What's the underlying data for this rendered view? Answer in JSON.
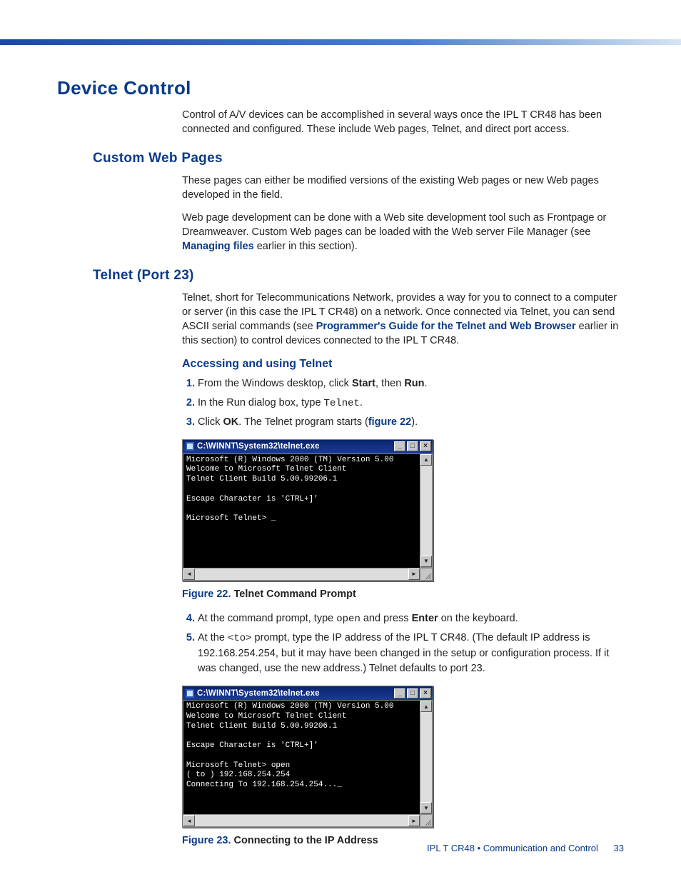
{
  "h1": "Device Control",
  "intro": "Control of A/V devices can be accomplished in several ways once the IPL T CR48 has been connected and configured. These include Web pages, Telnet, and direct port access.",
  "sections": {
    "cwp": {
      "title": "Custom Web Pages",
      "p1": "These pages can either be modified versions of the existing Web pages or new Web pages developed in the field.",
      "p2a": "Web page development can be done with a Web site development tool such as Frontpage or Dreamweaver. Custom Web pages can be loaded with the Web server File Manager (see ",
      "p2_link": "Managing files",
      "p2b": " earlier in this section)."
    },
    "telnet": {
      "title": "Telnet (Port 23)",
      "p1a": "Telnet, short for Telecommunications Network, provides a way for you to connect to a computer or server (in this case the IPL T CR48) on a network. Once connected via Telnet, you can send ASCII serial commands (see ",
      "p1_link": "Programmer's Guide for the Telnet and Web Browser",
      "p1b": " earlier in this section) to control devices connected to the IPL T CR48.",
      "h3": "Accessing and using Telnet",
      "steps": {
        "s1a": "From the Windows desktop, click ",
        "s1_start": "Start",
        "s1b": ", then ",
        "s1_run": "Run",
        "s1c": ".",
        "s2a": "In the Run dialog box, type ",
        "s2_code": "Telnet",
        "s2b": ".",
        "s3a": "Click ",
        "s3_ok": "OK",
        "s3b": ". The Telnet program starts (",
        "s3_fig": "figure 22",
        "s3c": ").",
        "s4a": "At the command prompt, type ",
        "s4_code": "open",
        "s4b": " and press ",
        "s4_enter": "Enter",
        "s4c": " on the keyboard.",
        "s5a": "At the ",
        "s5_code": "<to>",
        "s5b": " prompt, type the IP address of the IPL T CR48. (The default IP address is 192.168.254.254, but it may have been changed in the setup or configuration process. If it was changed, use the new address.) Telnet defaults to port 23."
      }
    }
  },
  "figures": {
    "f22": {
      "label": "Figure 22.",
      "title": "Telnet Command Prompt"
    },
    "f23": {
      "label": "Figure 23.",
      "title": "Connecting to the IP Address"
    }
  },
  "console": {
    "title": "C:\\WINNT\\System32\\telnet.exe",
    "body1": "Microsoft (R) Windows 2000 (TM) Version 5.00\nWelcome to Microsoft Telnet Client\nTelnet Client Build 5.00.99206.1\n\nEscape Character is 'CTRL+]'\n\nMicrosoft Telnet> _",
    "body2": "Microsoft (R) Windows 2000 (TM) Version 5.00\nWelcome to Microsoft Telnet Client\nTelnet Client Build 5.00.99206.1\n\nEscape Character is 'CTRL+]'\n\nMicrosoft Telnet> open\n( to ) 192.168.254.254\nConnecting To 192.168.254.254..._"
  },
  "footer": {
    "doc": "IPL T CR48 • Communication and Control",
    "page": "33"
  }
}
